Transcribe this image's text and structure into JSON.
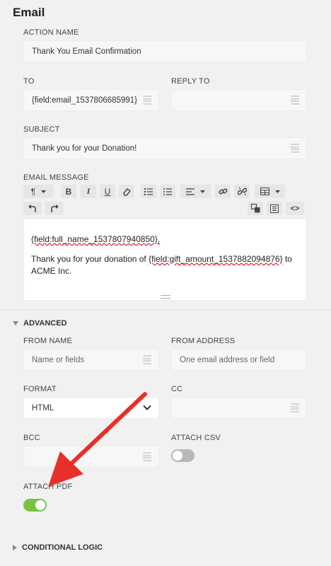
{
  "section": {
    "title": "Email"
  },
  "action_name": {
    "label": "ACTION NAME",
    "value": "Thank You Email Confirmation"
  },
  "to": {
    "label": "TO",
    "value": "{field:email_1537806685991}"
  },
  "reply_to": {
    "label": "REPLY TO",
    "value": ""
  },
  "subject": {
    "label": "SUBJECT",
    "value": "Thank you for your Donation!"
  },
  "email_message": {
    "label": "EMAIL MESSAGE",
    "toolbar": {
      "paragraph": "¶",
      "bold": "B",
      "italic": "I",
      "underline": "U",
      "code_view": "<>"
    },
    "line1": "{field:full_name_1537807940850},",
    "line2_prefix": "Thank you for your donation of ",
    "line2_field": "{field:gift_amount_1537882094876}",
    "line2_suffix": " to ACME Inc."
  },
  "advanced": {
    "label": "ADVANCED",
    "from_name": {
      "label": "FROM NAME",
      "placeholder": "Name or fields"
    },
    "from_address": {
      "label": "FROM ADDRESS",
      "placeholder": "One email address or field"
    },
    "format": {
      "label": "FORMAT",
      "value": "HTML"
    },
    "cc": {
      "label": "CC",
      "value": ""
    },
    "bcc": {
      "label": "BCC",
      "value": ""
    },
    "attach_csv": {
      "label": "ATTACH CSV",
      "on": false
    },
    "attach_pdf": {
      "label": "ATTACH PDF",
      "on": true
    }
  },
  "conditional_logic": {
    "label": "CONDITIONAL LOGIC"
  },
  "colors": {
    "toggle_on": "#7ac142",
    "toggle_off": "#b8b8b8",
    "annotation_arrow": "#e8302a"
  }
}
